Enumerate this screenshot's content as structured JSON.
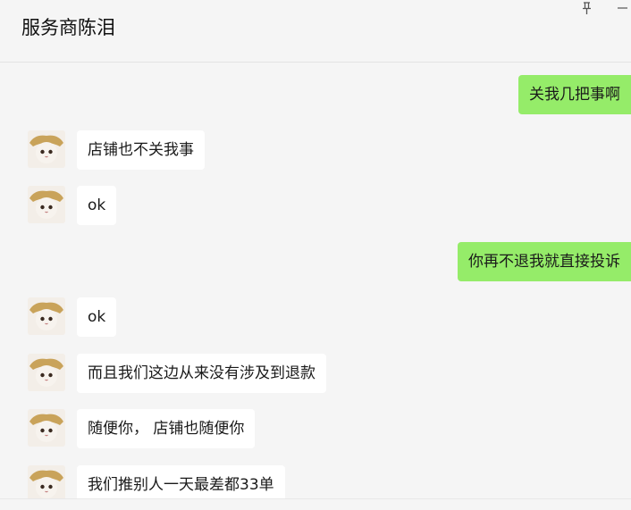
{
  "header": {
    "title": "服务商陈泪",
    "pin_icon": "pin-icon",
    "minimize_icon": "minimize-icon"
  },
  "messages": [
    {
      "side": "out",
      "text": "关我几把事啊"
    },
    {
      "side": "in",
      "text": "店铺也不关我事"
    },
    {
      "side": "in",
      "text": "ok"
    },
    {
      "side": "out",
      "text": "你再不退我就直接投诉"
    },
    {
      "side": "in",
      "text": "ok"
    },
    {
      "side": "in",
      "text": "而且我们这边从来没有涉及到退款"
    },
    {
      "side": "in",
      "text": "随便你， 店铺也随便你"
    },
    {
      "side": "in",
      "text": "我们推别人一天最差都33单"
    }
  ],
  "colors": {
    "outgoing_bubble": "#95ec69",
    "incoming_bubble": "#ffffff",
    "background": "#f5f5f5"
  }
}
